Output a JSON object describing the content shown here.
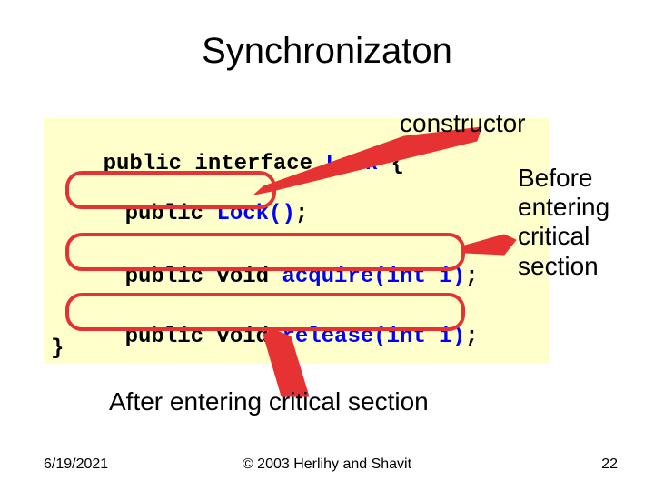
{
  "title": "Synchronizaton",
  "code": {
    "line1_pre": "public interface ",
    "line1_name": "Lock",
    "line1_post": " {",
    "line2_pre": "public ",
    "line2_name": "Lock()",
    "line2_post": ";",
    "line3_pre": "public void ",
    "line3_name": "acquire(int i)",
    "line3_post": ";",
    "line4_pre": "public void ",
    "line4_name": "release(int i)",
    "line4_post": ";",
    "close": "}"
  },
  "callouts": {
    "constructor": "constructor",
    "before": "Before\nentering\ncritical\nsection",
    "after": "After entering critical section"
  },
  "footer": {
    "date": "6/19/2021",
    "copyright": "© 2003 Herlihy and Shavit",
    "page": "22"
  },
  "colors": {
    "callout_red": "#e63232",
    "code_bg": "#ffffcc",
    "code_name": "#0000ff"
  }
}
